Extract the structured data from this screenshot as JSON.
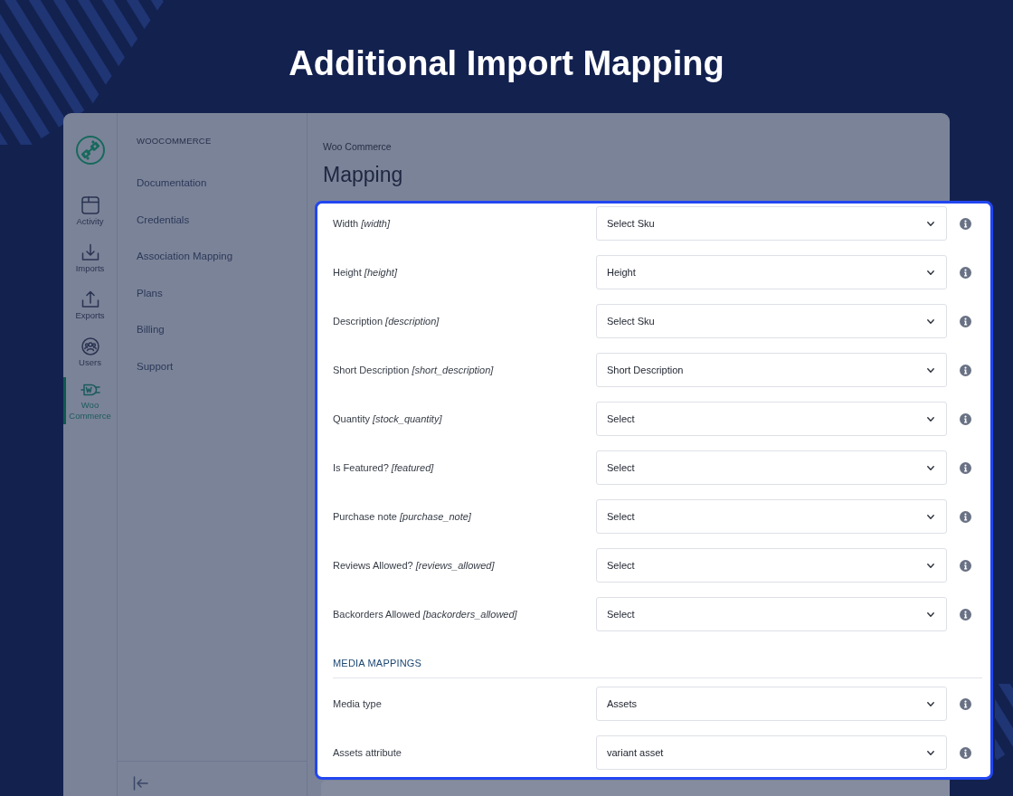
{
  "title": "Additional Import Mapping",
  "rail": {
    "items": [
      {
        "label": "Activity",
        "selected": false
      },
      {
        "label": "Imports",
        "selected": false
      },
      {
        "label": "Exports",
        "selected": false
      },
      {
        "label": "Users",
        "selected": false
      },
      {
        "label": "Woo Commerce",
        "selected": true
      }
    ]
  },
  "sidebar": {
    "heading": "WOOCOMMERCE",
    "items": [
      "Documentation",
      "Credentials",
      "Association Mapping",
      "Plans",
      "Billing",
      "Support"
    ]
  },
  "main": {
    "breadcrumb": "Woo Commerce",
    "heading": "Mapping"
  },
  "mapping": {
    "rows": [
      {
        "label": "Width *[width]*",
        "value": "Select Sku"
      },
      {
        "label": "Height *[height]*",
        "value": "Height"
      },
      {
        "label": "Description *[description]*",
        "value": "Select Sku"
      },
      {
        "label": "Short Description *[short_description]*",
        "value": "Short Description"
      },
      {
        "label": "Quantity *[stock_quantity]*",
        "value": "Select"
      },
      {
        "label": "Is Featured? *[featured]*",
        "value": "Select"
      },
      {
        "label": "Purchase note *[purchase_note]*",
        "value": "Select"
      },
      {
        "label": "Reviews Allowed? *[reviews_allowed]*",
        "value": "Select"
      },
      {
        "label": "Backorders Allowed *[backorders_allowed]*",
        "value": "Select"
      }
    ],
    "media_section": {
      "heading": "MEDIA MAPPINGS",
      "rows": [
        {
          "label": "Media type",
          "value": "Assets"
        },
        {
          "label": "Assets attribute",
          "value": "variant asset"
        }
      ]
    }
  }
}
